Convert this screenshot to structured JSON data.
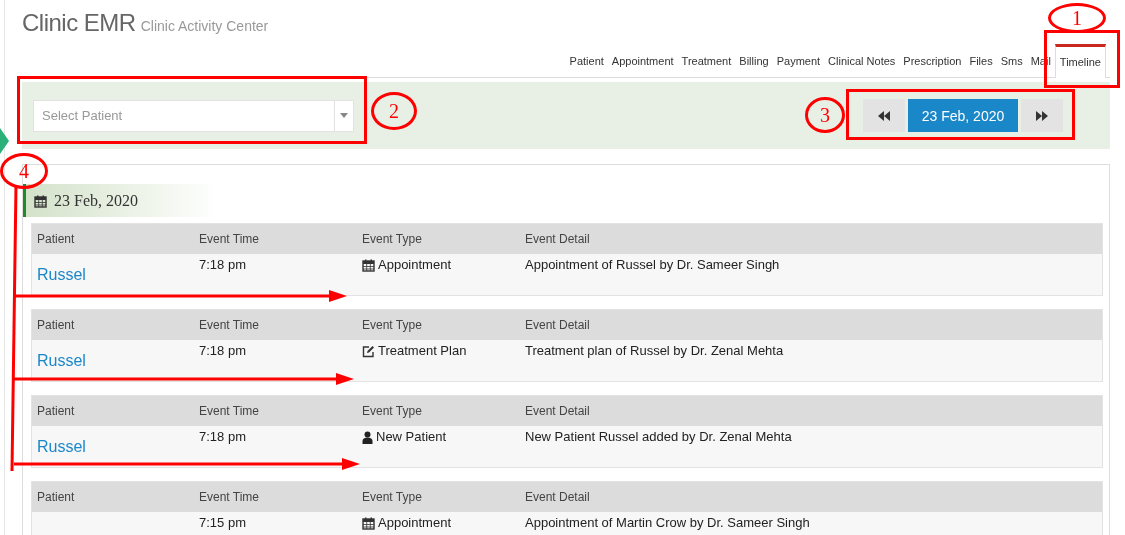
{
  "header": {
    "title": "Clinic EMR",
    "subtitle": "Clinic Activity Center"
  },
  "tabs": [
    {
      "label": "Patient",
      "selected": false
    },
    {
      "label": "Appointment",
      "selected": false
    },
    {
      "label": "Treatment",
      "selected": false
    },
    {
      "label": "Billing",
      "selected": false
    },
    {
      "label": "Payment",
      "selected": false
    },
    {
      "label": "Clinical Notes",
      "selected": false
    },
    {
      "label": "Prescription",
      "selected": false
    },
    {
      "label": "Files",
      "selected": false
    },
    {
      "label": "Sms",
      "selected": false
    },
    {
      "label": "Mail",
      "selected": false
    },
    {
      "label": "Timeline",
      "selected": true
    }
  ],
  "filter": {
    "patient_select": {
      "placeholder": "Select Patient"
    },
    "date_nav": {
      "date": "23 Feb, 2020"
    }
  },
  "timeline": {
    "date": "23 Feb, 2020",
    "events": [
      {
        "columns": [
          "Patient",
          "Event Time",
          "Event Type",
          "Event Detail"
        ],
        "patient": "Russel",
        "time": "7:18 pm",
        "kind": "appointment",
        "type": "Appointment",
        "detail": "Appointment of Russel by Dr. Sameer Singh"
      },
      {
        "columns": [
          "Patient",
          "Event Time",
          "Event Type",
          "Event Detail"
        ],
        "patient": "Russel",
        "time": "7:18 pm",
        "kind": "treatment",
        "type": "Treatment Plan",
        "detail": "Treatment plan of Russel by Dr. Zenal Mehta"
      },
      {
        "columns": [
          "Patient",
          "Event Time",
          "Event Type",
          "Event Detail"
        ],
        "patient": "Russel",
        "time": "7:18 pm",
        "kind": "patient",
        "type": "New Patient",
        "detail": "New Patient Russel added by Dr. Zenal Mehta"
      },
      {
        "columns": [
          "Patient",
          "Event Time",
          "Event Type",
          "Event Detail"
        ],
        "time": "7:15 pm",
        "kind": "appointment",
        "type": "Appointment",
        "detail": "Appointment of Martin Crow by Dr. Sameer Singh"
      }
    ]
  },
  "annotations": [
    {
      "number": "1",
      "kind": "box"
    },
    {
      "number": "2",
      "kind": "box"
    },
    {
      "number": "3",
      "kind": "box"
    },
    {
      "number": "4",
      "kind": "arrows"
    }
  ]
}
